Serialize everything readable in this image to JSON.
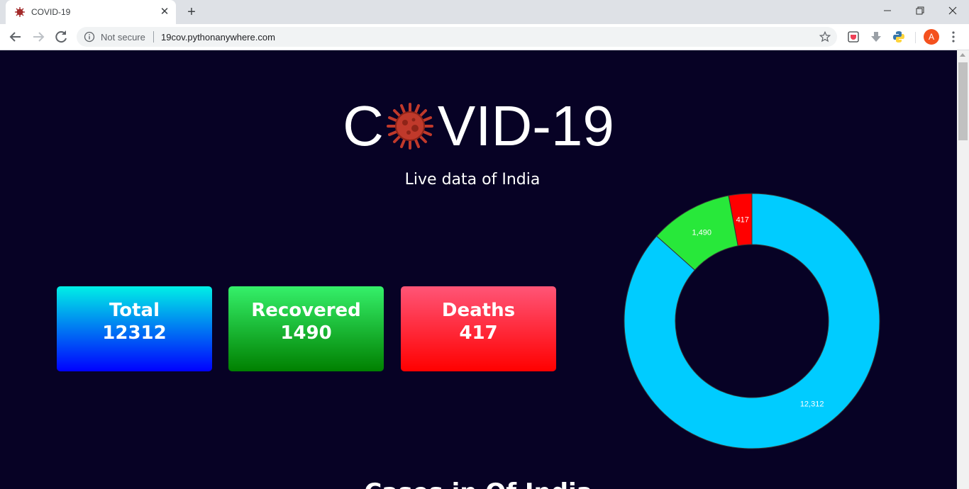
{
  "browser": {
    "tab_title": "COVID-19",
    "not_secure": "Not secure",
    "url": "19cov.pythonanywhere.com",
    "avatar_letter": "A"
  },
  "page": {
    "hero_prefix": "C",
    "hero_suffix": "VID-19",
    "subtitle": "Live data of India",
    "cards": {
      "total": {
        "label": "Total",
        "value": "12312"
      },
      "recovered": {
        "label": "Recovered",
        "value": "1490"
      },
      "deaths": {
        "label": "Deaths",
        "value": "417"
      }
    },
    "next_heading": "Cases in Of India"
  },
  "colors": {
    "page_bg": "#070225",
    "total": "#00ccff",
    "recovered": "#28e83a",
    "deaths": "#ff0000"
  },
  "chart_data": {
    "type": "pie",
    "donut": true,
    "categories": [
      "Total",
      "Recovered",
      "Deaths"
    ],
    "values": [
      12312,
      1490,
      417
    ],
    "labels": [
      "12,312",
      "1,490",
      "417"
    ],
    "colors": [
      "#00ccff",
      "#28e83a",
      "#ff0000"
    ],
    "title": ""
  }
}
